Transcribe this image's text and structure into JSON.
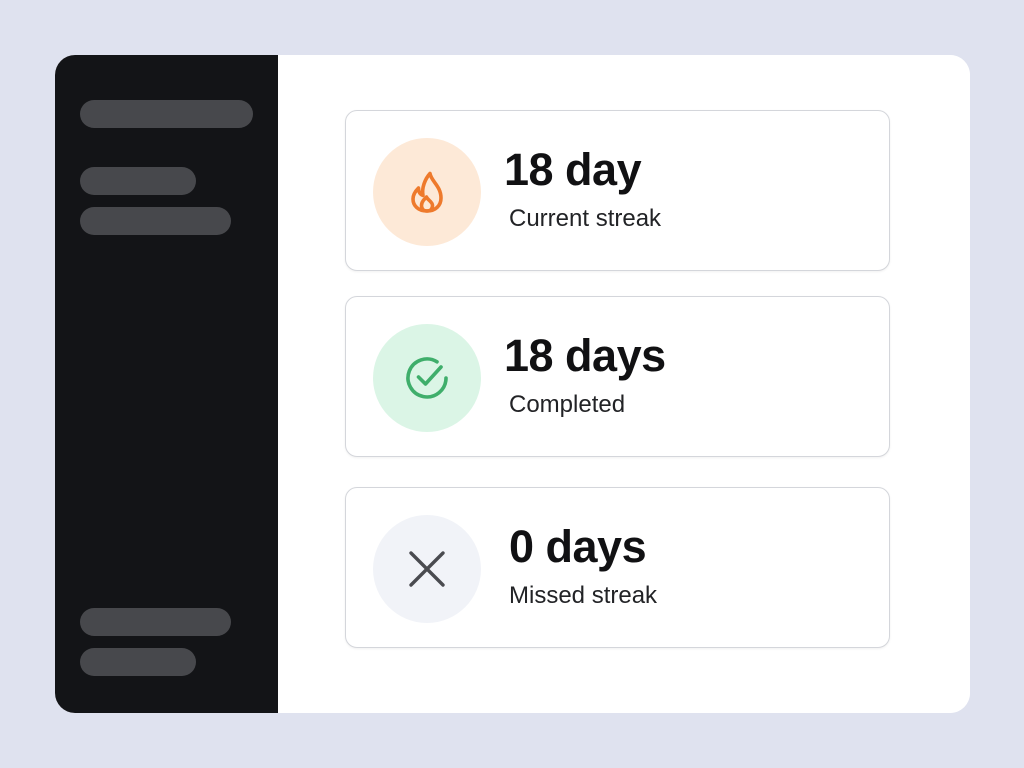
{
  "stats": [
    {
      "value": "18 day",
      "label": "Current streak",
      "icon": "flame-icon",
      "icon_color": "#ee7a2c",
      "icon_bg": "#fde9d7"
    },
    {
      "value": "18 days",
      "label": "Completed",
      "icon": "check-circle-icon",
      "icon_color": "#3fae6b",
      "icon_bg": "#dbf5e6"
    },
    {
      "value": "0 days",
      "label": "Missed streak",
      "icon": "close-icon",
      "icon_color": "#4a4b50",
      "icon_bg": "#f1f3f8"
    }
  ],
  "colors": {
    "page_background": "#dfe2ef",
    "sidebar_background": "#131417",
    "sidebar_placeholder": "#47484c",
    "card_border": "#d4d6db"
  }
}
